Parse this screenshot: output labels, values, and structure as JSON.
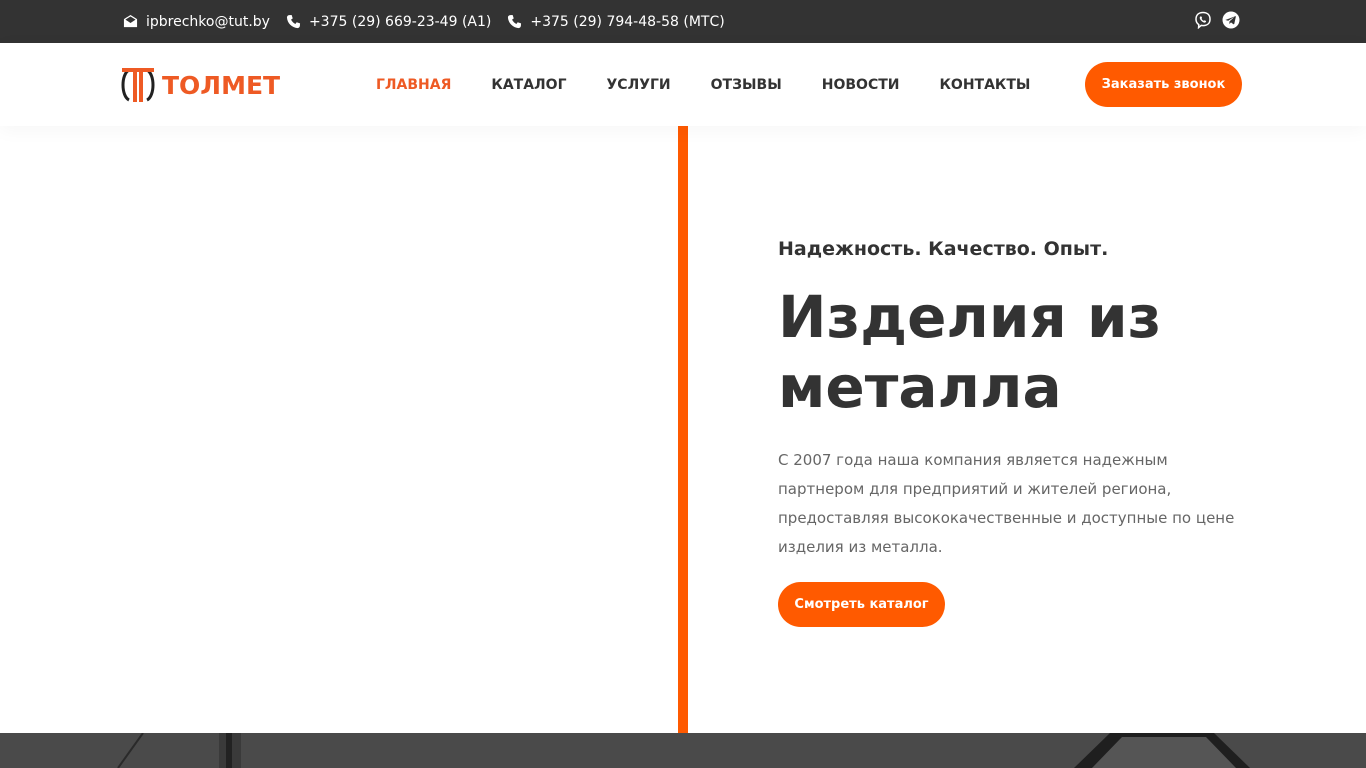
{
  "topbar": {
    "email": "ipbrechko@tut.by",
    "phone_1": "+375 (29) 669-23-49 (A1)",
    "phone_2": "+375 (29) 794-48-58 (МТС)",
    "social": [
      {
        "icon": "viber-icon"
      },
      {
        "icon": "telegram-icon"
      }
    ]
  },
  "header": {
    "logo_text": "ТОЛМЕТ",
    "nav": [
      {
        "label": "ГЛАВНАЯ",
        "active": true
      },
      {
        "label": "КАТАЛОГ",
        "active": false
      },
      {
        "label": "УСЛУГИ",
        "active": false
      },
      {
        "label": "ОТЗЫВЫ",
        "active": false
      },
      {
        "label": "НОВОСТИ",
        "active": false
      },
      {
        "label": "КОНТАКТЫ",
        "active": false
      }
    ],
    "callback_label": "Заказать звонок"
  },
  "hero": {
    "tagline": "Надежность. Качество. Опыт.",
    "title": "Изделия из металла",
    "description": "С 2007 года наша компания является надежным партнером для предприятий и жителей региона, предоставляя высококачественные и доступные по цене изделия из металла.",
    "cta_label": "Смотреть каталог"
  },
  "colors": {
    "accent": "#ff5a00",
    "logo": "#ee5a24",
    "dark": "#333333",
    "text_muted": "#666666"
  }
}
